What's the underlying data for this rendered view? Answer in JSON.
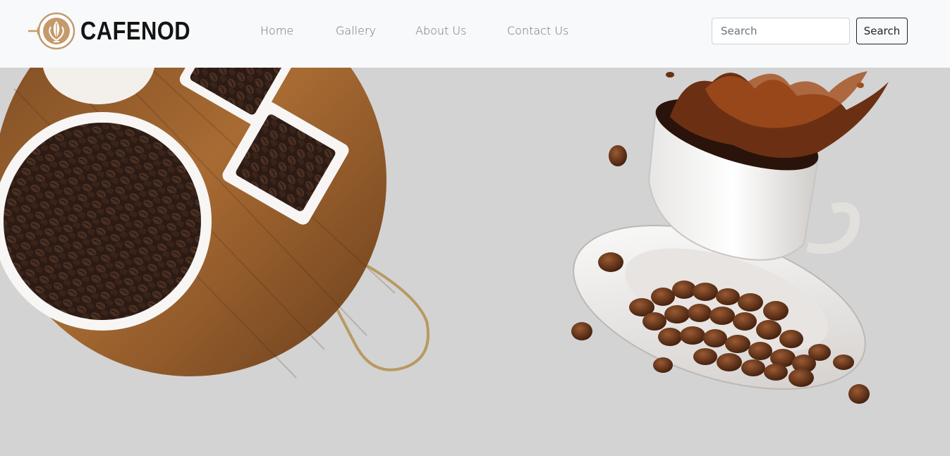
{
  "brand": {
    "name": "CAFENOD",
    "logo_icon": "latte-art-cup-icon"
  },
  "nav": {
    "items": [
      "Home",
      "Gallery",
      "About Us",
      "Contact Us"
    ]
  },
  "search": {
    "placeholder": "Search",
    "value": "",
    "button_label": "Search"
  },
  "hero": {
    "left_image": "coffee-beans-on-wooden-board-image",
    "right_image": "coffee-cup-splash-with-beans-image"
  },
  "colors": {
    "navbar_bg": "#f8f9fa",
    "hero_bg": "#d3d3d3",
    "brand_text": "#141414",
    "logo_accent": "#c49a6c"
  }
}
